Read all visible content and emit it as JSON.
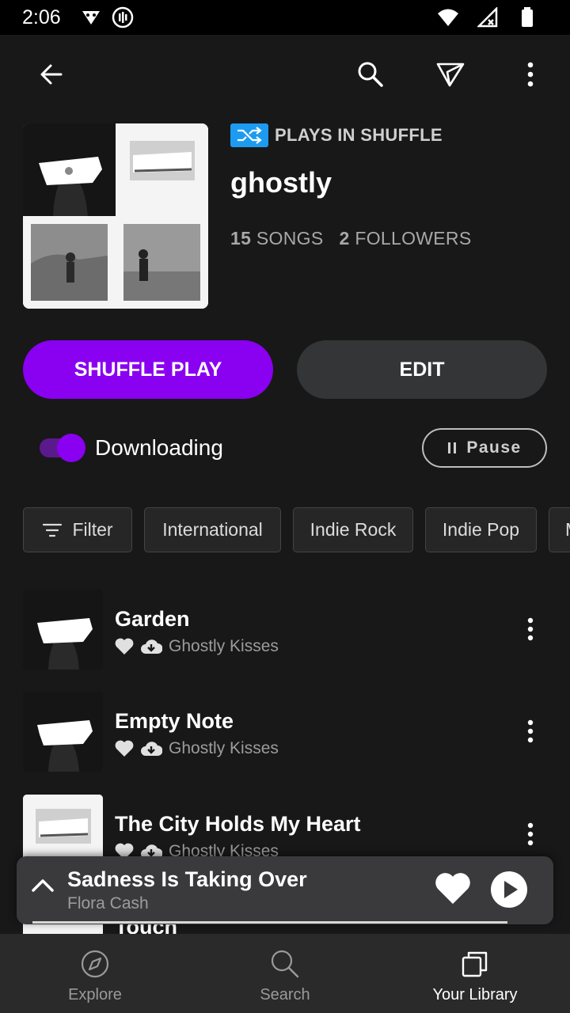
{
  "status_bar": {
    "time": "2:06"
  },
  "header": {
    "shuffle_label": "PLAYS IN SHUFFLE",
    "title": "ghostly",
    "songs_count": "15",
    "songs_label": "SONGS",
    "followers_count": "2",
    "followers_label": "FOLLOWERS"
  },
  "actions": {
    "shuffle_play_label": "SHUFFLE PLAY",
    "edit_label": "EDIT",
    "downloading_label": "Downloading",
    "downloading_on": true,
    "pause_label": "Pause"
  },
  "chips": [
    {
      "label": "Filter"
    },
    {
      "label": "International"
    },
    {
      "label": "Indie Rock"
    },
    {
      "label": "Indie Pop"
    },
    {
      "label": "M"
    }
  ],
  "songs": [
    {
      "title": "Garden",
      "artist": "Ghostly Kisses"
    },
    {
      "title": "Empty Note",
      "artist": "Ghostly Kisses"
    },
    {
      "title": "The City Holds My Heart",
      "artist": "Ghostly Kisses"
    },
    {
      "title": "Touch",
      "artist": ""
    }
  ],
  "mini_player": {
    "title": "Sadness Is Taking Over",
    "artist": "Flora Cash",
    "progress": 0.9
  },
  "bottom_nav": [
    {
      "label": "Explore",
      "icon": "compass-icon"
    },
    {
      "label": "Search",
      "icon": "search-icon"
    },
    {
      "label": "Your Library",
      "icon": "library-icon",
      "active": true
    }
  ],
  "colors": {
    "accent": "#8a00f0",
    "shuffle_badge": "#1d9bf0",
    "background": "#181818"
  }
}
